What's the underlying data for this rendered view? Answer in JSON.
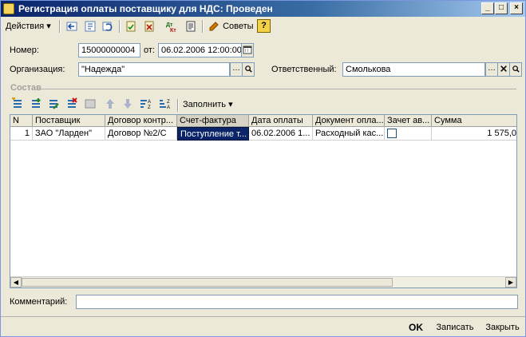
{
  "window": {
    "title": "Регистрация оплаты поставщику для НДС: Проведен",
    "controls": [
      "_",
      "□",
      "×"
    ]
  },
  "toolbar": {
    "actions_label": "Действия",
    "actions_arrow": "▾",
    "icons": [
      "back-icon",
      "structure-icon",
      "refresh-icon",
      "post-icon",
      "unpost-icon",
      "dt-kt-icon",
      "report-icon"
    ],
    "tips_label": "Советы",
    "help_label": "?",
    "colors": {
      "tips": "#d27b00",
      "help": "#f3d24a"
    }
  },
  "form": {
    "number_label": "Номер:",
    "number_value": "15000000004",
    "date_label": "от:",
    "date_value": "06.02.2006 12:00:00",
    "org_label": "Организация:",
    "org_value": "\"Надежда\"",
    "resp_label": "Ответственный:",
    "resp_value": "Смолькова"
  },
  "section": {
    "title": "Состав",
    "fill_label": "Заполнить"
  },
  "table": {
    "columns": [
      "N",
      "Поставщик",
      "Договор контр...",
      "Счет-фактура",
      "Дата оплаты",
      "Документ опла...",
      "Зачет ав...",
      "Сумма"
    ],
    "rows": [
      [
        "1",
        "ЗАО \"Ларден\"",
        "Договор №2/С",
        "Поступление т...",
        "06.02.2006 1...",
        "Расходный кас...",
        "",
        "1 575,0"
      ]
    ]
  },
  "comment": {
    "label": "Комментарий:",
    "value": ""
  },
  "buttons": {
    "ok": "OK",
    "save": "Записать",
    "close": "Закрыть"
  }
}
